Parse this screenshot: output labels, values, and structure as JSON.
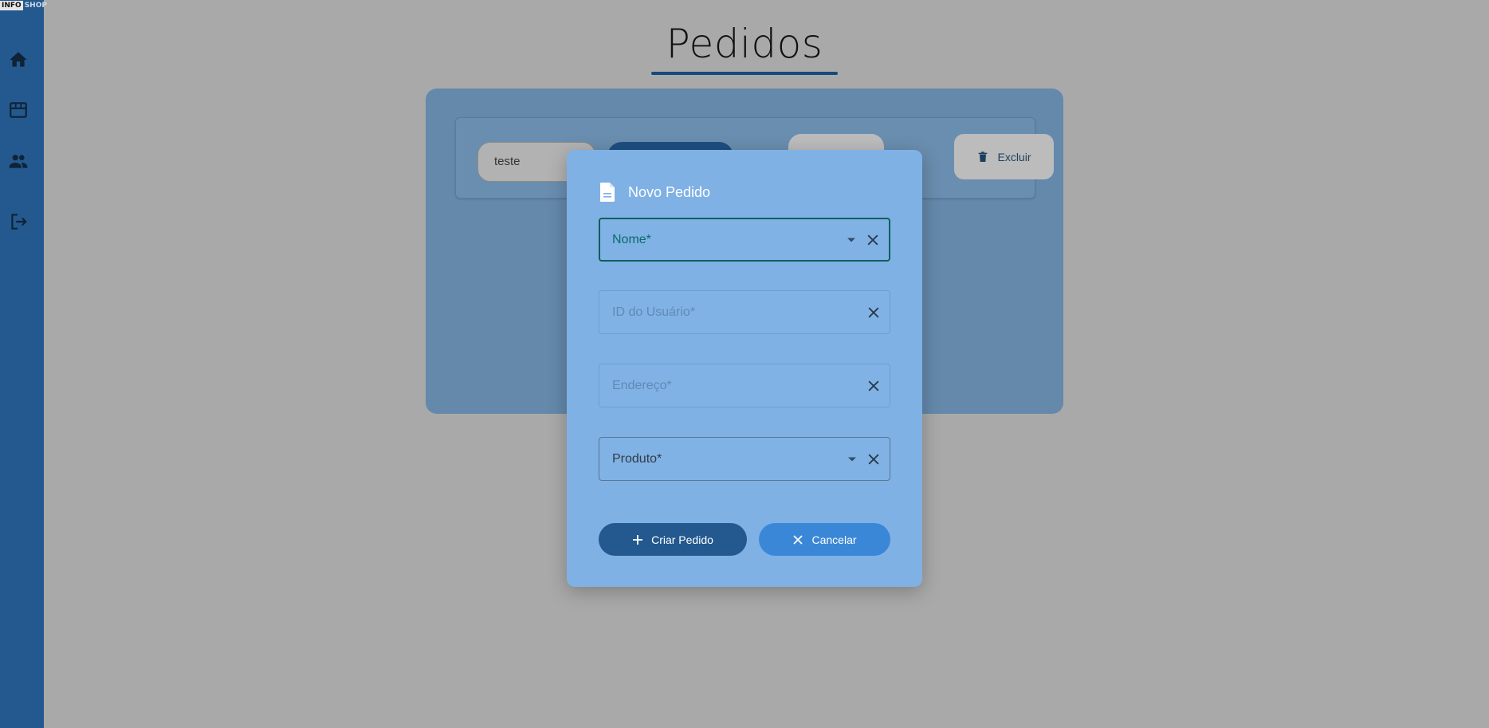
{
  "app": {
    "logo_part1": "INFO",
    "logo_part2": "SHOP"
  },
  "sidebar": {
    "items": [
      {
        "icon": "home-icon"
      },
      {
        "icon": "store-icon"
      },
      {
        "icon": "people-icon"
      },
      {
        "icon": "logout-icon"
      }
    ]
  },
  "page": {
    "title": "Pedidos"
  },
  "toolbar": {
    "search_value": "teste",
    "delete_label": "Excluir"
  },
  "modal": {
    "title": "Novo Pedido",
    "fields": {
      "nome": "Nome*",
      "user_id": "ID do Usuário*",
      "endereco": "Endereço*",
      "produto": "Produto*"
    },
    "create_label": "Criar Pedido",
    "cancel_label": "Cancelar"
  },
  "colors": {
    "sidebar": "#23598f",
    "modal": "#7fb1e5",
    "primary_button": "#23598f",
    "secondary_button": "#3b87d7",
    "focus": "#0a5f5f"
  }
}
